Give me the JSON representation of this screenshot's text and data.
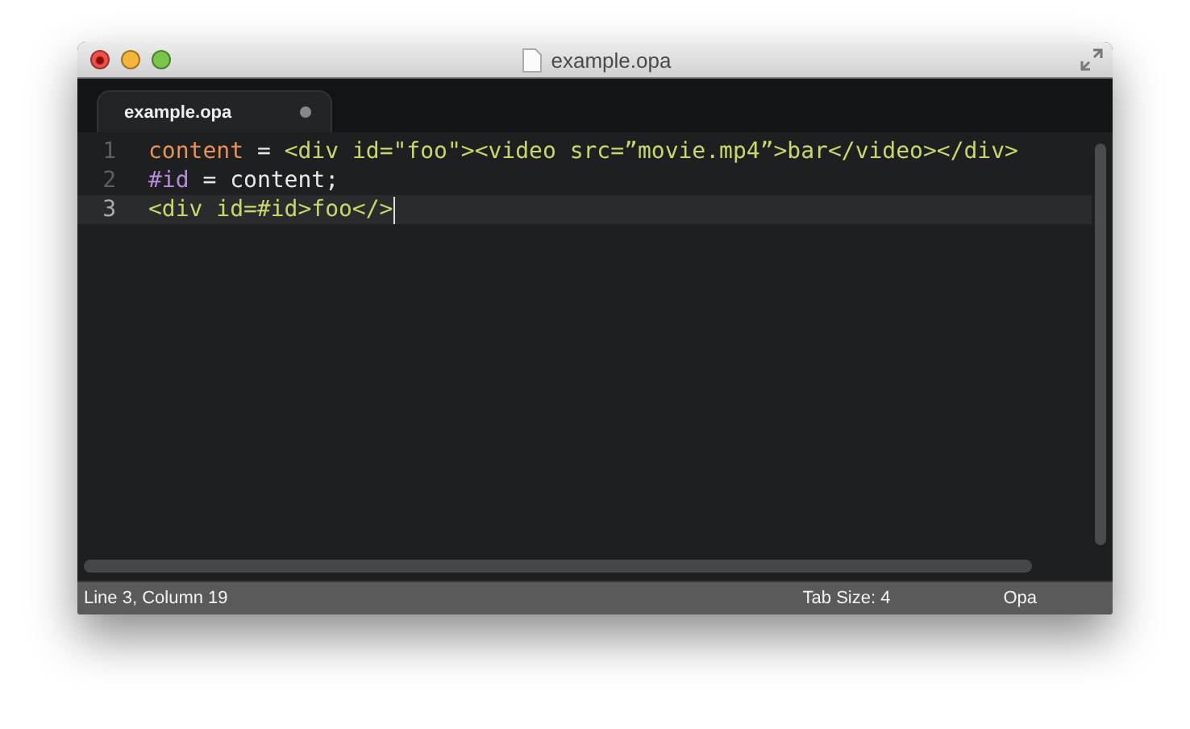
{
  "window": {
    "title": "example.opa"
  },
  "tabs": [
    {
      "label": "example.opa",
      "selected": true,
      "modified": true
    }
  ],
  "editor": {
    "lines": [
      {
        "number": "1",
        "current": false,
        "tokens": [
          {
            "kind": "variable",
            "text": "content"
          },
          {
            "kind": "plain",
            "text": " = "
          },
          {
            "kind": "markup",
            "text": "<div id=\"foo\"><video src=”movie.mp4”>bar</video></div>"
          }
        ]
      },
      {
        "number": "2",
        "current": false,
        "tokens": [
          {
            "kind": "dom_id",
            "text": "#id"
          },
          {
            "kind": "plain",
            "text": " = content;"
          }
        ]
      },
      {
        "number": "3",
        "current": true,
        "tokens": [
          {
            "kind": "markup",
            "text": "<div id=#id>foo</>"
          }
        ]
      }
    ]
  },
  "status_bar": {
    "position": "Line 3, Column 19",
    "tab_size": "Tab Size: 4",
    "syntax": "Opa"
  }
}
